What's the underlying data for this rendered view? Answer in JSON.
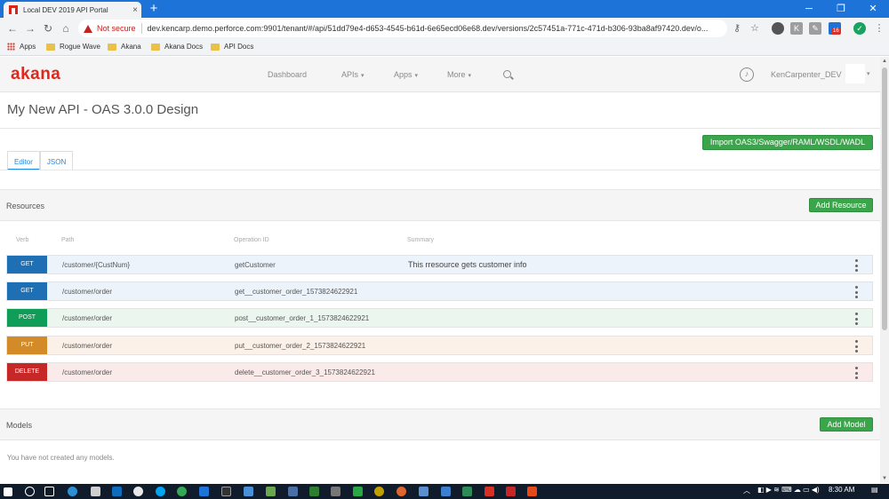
{
  "browser": {
    "tab_title": "Local DEV 2019 API Portal",
    "tab_close": "×",
    "new_tab": "+",
    "not_secure": "Not secure",
    "url": "dev.kencarp.demo.perforce.com:9901/tenant/#/api/51dd79e4-d653-4545-b61d-6e65ecd06e68.dev/versions/2c57451a-771c-471d-b306-93ba8af97420.dev/o...",
    "bookmarks": [
      "Apps",
      "Rogue Wave",
      "Akana",
      "Akana Docs",
      "API Docs"
    ],
    "ext_badge": "16"
  },
  "header": {
    "logo": "akana",
    "nav": [
      "Dashboard",
      "APIs",
      "Apps",
      "More"
    ],
    "username": "KenCarpenter_DEV"
  },
  "page": {
    "title": "My New API - OAS 3.0.0 Design",
    "import_button": "Import OAS3/Swagger/RAML/WSDL/WADL",
    "tabs": [
      "Editor",
      "JSON"
    ]
  },
  "resources": {
    "title": "Resources",
    "add_button": "Add Resource",
    "columns": [
      "Verb",
      "Path",
      "Operation ID",
      "Summary"
    ],
    "rows": [
      {
        "verb": "GET",
        "path": "/customer/{CustNum}",
        "operation_id": "getCustomer",
        "summary": "This rresource gets customer info"
      },
      {
        "verb": "GET",
        "path": "/customer/order",
        "operation_id": "get__customer_order_1573824622921",
        "summary": ""
      },
      {
        "verb": "POST",
        "path": "/customer/order",
        "operation_id": "post__customer_order_1_1573824622921",
        "summary": ""
      },
      {
        "verb": "PUT",
        "path": "/customer/order",
        "operation_id": "put__customer_order_2_1573824622921",
        "summary": ""
      },
      {
        "verb": "DELETE",
        "path": "/customer/order",
        "operation_id": "delete__customer_order_3_1573824622921",
        "summary": ""
      }
    ]
  },
  "models": {
    "title": "Models",
    "add_button": "Add Model",
    "empty_text": "You have not created any models."
  },
  "taskbar": {
    "time": "8:30 AM"
  },
  "colors": {
    "get": "#1f6fb5",
    "post": "#0f9d58",
    "put": "#d28b26",
    "delete": "#c62828",
    "accent_green": "#3aa54a",
    "brand_red": "#e2261b"
  }
}
